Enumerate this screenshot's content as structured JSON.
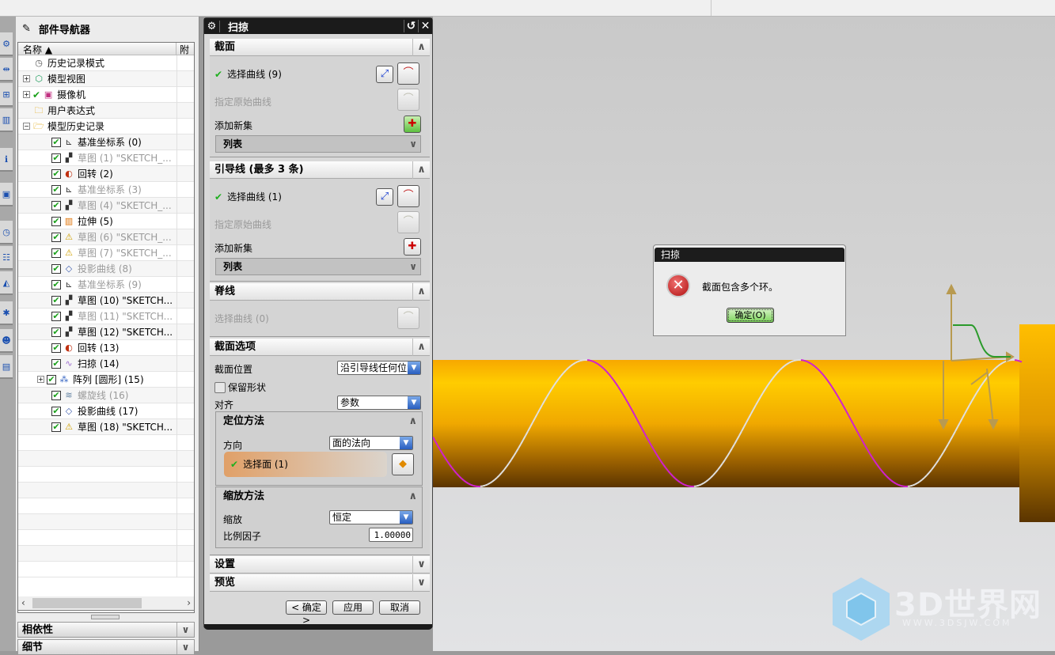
{
  "navigator": {
    "title": "部件导航器",
    "columns": [
      "名称",
      "附"
    ],
    "rows": [
      {
        "label": "历史记录模式",
        "level": 0,
        "icon": "clock-icon",
        "check": false,
        "dim": false,
        "expand": ""
      },
      {
        "label": "模型视图",
        "level": 0,
        "icon": "model-view-icon",
        "check": false,
        "dim": false,
        "expand": "+"
      },
      {
        "label": "摄像机",
        "level": 0,
        "icon": "camera-icon",
        "check": "tick",
        "dim": false,
        "expand": "+"
      },
      {
        "label": "用户表达式",
        "level": 0,
        "icon": "folder-icon",
        "check": false,
        "dim": false,
        "expand": ""
      },
      {
        "label": "模型历史记录",
        "level": 0,
        "icon": "folder-open-icon",
        "check": false,
        "dim": false,
        "expand": "-"
      },
      {
        "label": "基准坐标系 (0)",
        "level": 1,
        "icon": "datum-csys-icon",
        "check": true,
        "dim": false,
        "expand": ""
      },
      {
        "label": "草图 (1) \"SKETCH_...",
        "level": 1,
        "icon": "sketch-icon",
        "check": true,
        "dim": true,
        "expand": ""
      },
      {
        "label": "回转 (2)",
        "level": 1,
        "icon": "revolve-icon",
        "check": true,
        "dim": false,
        "expand": ""
      },
      {
        "label": "基准坐标系 (3)",
        "level": 1,
        "icon": "datum-csys-icon",
        "check": true,
        "dim": true,
        "expand": ""
      },
      {
        "label": "草图 (4) \"SKETCH_...",
        "level": 1,
        "icon": "sketch-icon",
        "check": true,
        "dim": true,
        "expand": ""
      },
      {
        "label": "拉伸 (5)",
        "level": 1,
        "icon": "extrude-icon",
        "check": true,
        "dim": false,
        "expand": ""
      },
      {
        "label": "草图 (6) \"SKETCH_...",
        "level": 1,
        "icon": "sketch-warning-icon",
        "check": true,
        "dim": true,
        "expand": ""
      },
      {
        "label": "草图 (7) \"SKETCH_...",
        "level": 1,
        "icon": "sketch-warning-icon",
        "check": true,
        "dim": true,
        "expand": ""
      },
      {
        "label": "投影曲线 (8)",
        "level": 1,
        "icon": "project-curve-icon",
        "check": true,
        "dim": true,
        "expand": ""
      },
      {
        "label": "基准坐标系 (9)",
        "level": 1,
        "icon": "datum-csys-icon",
        "check": true,
        "dim": true,
        "expand": ""
      },
      {
        "label": "草图 (10) \"SKETCH...",
        "level": 1,
        "icon": "sketch-icon",
        "check": true,
        "dim": false,
        "expand": ""
      },
      {
        "label": "草图 (11) \"SKETCH...",
        "level": 1,
        "icon": "sketch-icon",
        "check": true,
        "dim": true,
        "expand": ""
      },
      {
        "label": "草图 (12) \"SKETCH...",
        "level": 1,
        "icon": "sketch-icon",
        "check": true,
        "dim": false,
        "expand": ""
      },
      {
        "label": "回转 (13)",
        "level": 1,
        "icon": "revolve-icon",
        "check": true,
        "dim": false,
        "expand": ""
      },
      {
        "label": "扫掠 (14)",
        "level": 1,
        "icon": "swept-icon",
        "check": true,
        "dim": false,
        "expand": ""
      },
      {
        "label": "阵列 [圆形] (15)",
        "level": 1,
        "icon": "pattern-icon",
        "check": true,
        "dim": false,
        "expand": "+"
      },
      {
        "label": "螺旋线 (16)",
        "level": 1,
        "icon": "helix-icon",
        "check": true,
        "dim": true,
        "expand": ""
      },
      {
        "label": "投影曲线 (17)",
        "level": 1,
        "icon": "project-curve-icon",
        "check": true,
        "dim": false,
        "expand": ""
      },
      {
        "label": "草图 (18) \"SKETCH...",
        "level": 1,
        "icon": "sketch-warning-icon",
        "check": true,
        "dim": false,
        "expand": ""
      }
    ],
    "sections": [
      "相依性",
      "细节"
    ]
  },
  "dialog": {
    "title": "扫掠",
    "section_group": {
      "title": "截面",
      "select_curve": "选择曲线 (9)",
      "specify_original": "指定原始曲线",
      "add_new_set": "添加新集",
      "list": "列表"
    },
    "guide_group": {
      "title": "引导线 (最多 3 条)",
      "select_curve": "选择曲线 (1)",
      "specify_original": "指定原始曲线",
      "add_new_set": "添加新集",
      "list": "列表"
    },
    "spine_group": {
      "title": "脊线",
      "select_curve": "选择曲线 (0)"
    },
    "options_group": {
      "title": "截面选项",
      "position_label": "截面位置",
      "position_value": "沿引导线任何位置",
      "preserve_shape": "保留形状",
      "preserve_shape_checked": false,
      "align_label": "对齐",
      "align_value": "参数",
      "orientation": {
        "title": "定位方法",
        "direction_label": "方向",
        "direction_value": "面的法向",
        "select_face": "选择面 (1)"
      },
      "scaling": {
        "title": "缩放方法",
        "scale_label": "缩放",
        "scale_value": "恒定",
        "factor_label": "比例因子",
        "factor_value": "1.00000"
      }
    },
    "settings": "设置",
    "preview": "预览",
    "buttons": {
      "ok": "< 确定 >",
      "apply": "应用",
      "cancel": "取消"
    }
  },
  "error_dialog": {
    "title": "扫掠",
    "message": "截面包含多个环。",
    "ok": "确定(O)"
  },
  "watermark": {
    "text": "3D世界网",
    "url": "WWW.3DSJW.COM"
  },
  "colors": {
    "cylinder": "#f5b800",
    "curve_magenta": "#d020d0",
    "curve_white": "#e0e0e0"
  }
}
